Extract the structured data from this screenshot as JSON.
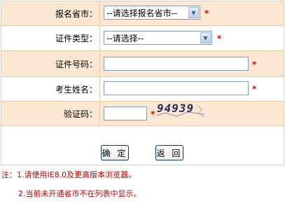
{
  "form": {
    "province": {
      "label": "报名省市：",
      "value": "--请选择报名省市--",
      "required": "*"
    },
    "id_type": {
      "label": "证件类型：",
      "value": "--请选择--",
      "required": "*"
    },
    "id_number": {
      "label": "证件号码：",
      "value": "",
      "required": "*"
    },
    "name": {
      "label": "考生姓名：",
      "value": "",
      "required": "*"
    },
    "captcha": {
      "label": "验证码：",
      "value": "",
      "required": "*",
      "image_text": "94939"
    }
  },
  "buttons": {
    "confirm": "确 定",
    "back": "返 回"
  },
  "notes": {
    "line1": "注：1.请使用IE8.0及更高版本浏览器。",
    "line2": "2.当前未开通省市不在列表中显示。"
  },
  "colors": {
    "row_alt_bg": "#fbe7d2",
    "border": "#e9c9a6",
    "required": "#e60000",
    "note": "#c00000"
  }
}
